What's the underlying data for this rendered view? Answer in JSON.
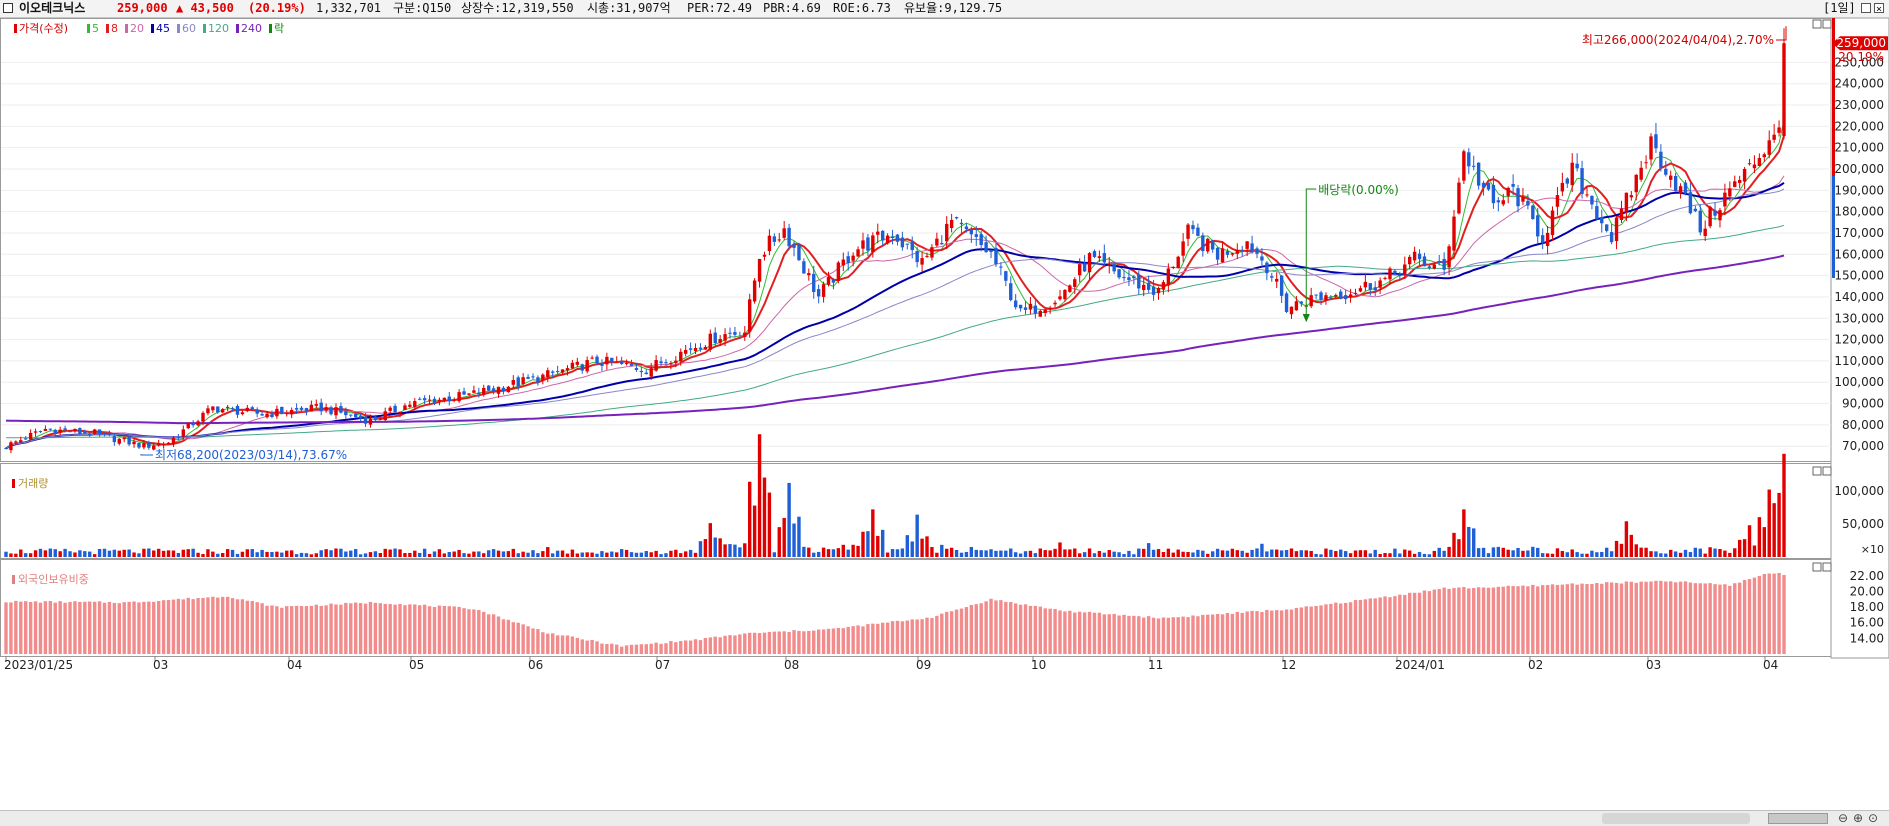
{
  "header": {
    "name": "이오테크닉스",
    "price": "259,000",
    "change": "▲ 43,500",
    "change_pct": "(20.19%)",
    "volume": "1,332,701",
    "market": "구분:Q150",
    "shares": "상장수:12,319,550",
    "mcap": "시총:31,907억",
    "per": "PER:72.49",
    "pbr": "PBR:4.69",
    "roe": "ROE:6.73",
    "float": "유보율:9,129.75",
    "period": "[1일]",
    "colors": {
      "up": "#e00000",
      "down": "#1f5fd6",
      "text": "#000000"
    }
  },
  "legend": {
    "price": "가격(수정)",
    "ma": [
      {
        "label": "5",
        "color": "#33bb33"
      },
      {
        "label": "8",
        "color": "#e02020"
      },
      {
        "label": "20",
        "color": "#cc66aa"
      },
      {
        "label": "45",
        "color": "#0000aa"
      },
      {
        "label": "60",
        "color": "#8888cc"
      },
      {
        "label": "120",
        "color": "#44aa88"
      },
      {
        "label": "240",
        "color": "#7722bb"
      }
    ],
    "ex": "락"
  },
  "annotations": {
    "high": "최고266,000(2024/04/04),2.70%",
    "low": "최저68,200(2023/03/14),73.67%",
    "dividend": "배당락(0.00%)",
    "last_price": "259,000",
    "last_pct": "20.19%"
  },
  "volume_panel": {
    "title": "거래량",
    "multiplier": "×10"
  },
  "foreign_panel": {
    "title": "외국인보유비중"
  },
  "xaxis_labels": [
    "2023/01/25",
    "03",
    "04",
    "05",
    "06",
    "07",
    "08",
    "09",
    "10",
    "11",
    "12",
    "2024/01",
    "02",
    "03",
    "04"
  ],
  "chart_data": [
    {
      "type": "candlestick",
      "title": "가격(수정)",
      "ylim": [
        64000,
        268000
      ],
      "yticks": [
        "70,000",
        "80,000",
        "90,000",
        "100,000",
        "110,000",
        "120,000",
        "130,000",
        "140,000",
        "150,000",
        "160,000",
        "170,000",
        "180,000",
        "190,000",
        "200,000",
        "210,000",
        "220,000",
        "230,000",
        "240,000",
        "250,000"
      ],
      "anchors": [
        [
          0,
          70000
        ],
        [
          8,
          78000
        ],
        [
          18,
          76000
        ],
        [
          28,
          70000
        ],
        [
          33,
          72000
        ],
        [
          42,
          88000
        ],
        [
          52,
          85000
        ],
        [
          64,
          88000
        ],
        [
          74,
          82000
        ],
        [
          82,
          90000
        ],
        [
          94,
          94000
        ],
        [
          108,
          102000
        ],
        [
          120,
          110000
        ],
        [
          130,
          106000
        ],
        [
          137,
          114000
        ],
        [
          145,
          122000
        ],
        [
          150,
          124000
        ],
        [
          153,
          160000
        ],
        [
          158,
          172000
        ],
        [
          165,
          140000
        ],
        [
          172,
          162000
        ],
        [
          180,
          170000
        ],
        [
          186,
          156000
        ],
        [
          192,
          175000
        ],
        [
          200,
          160000
        ],
        [
          206,
          132000
        ],
        [
          214,
          140000
        ],
        [
          220,
          158000
        ],
        [
          226,
          150000
        ],
        [
          234,
          142000
        ],
        [
          240,
          170000
        ],
        [
          246,
          160000
        ],
        [
          252,
          166000
        ],
        [
          256,
          155000
        ],
        [
          260,
          135000
        ],
        [
          266,
          140000
        ],
        [
          272,
          142000
        ],
        [
          280,
          148000
        ],
        [
          286,
          158000
        ],
        [
          292,
          152000
        ],
        [
          296,
          208000
        ],
        [
          302,
          182000
        ],
        [
          306,
          190000
        ],
        [
          312,
          168000
        ],
        [
          318,
          200000
        ],
        [
          326,
          168000
        ],
        [
          334,
          212000
        ],
        [
          340,
          190000
        ],
        [
          344,
          172000
        ],
        [
          350,
          190000
        ],
        [
          354,
          200000
        ],
        [
          357,
          210000
        ],
        [
          360,
          222000
        ]
      ],
      "last": {
        "open": 215500,
        "high": 266000,
        "low": 214000,
        "close": 259000
      },
      "moving_averages": [
        {
          "period": 5,
          "color": "#33bb33",
          "width": 1
        },
        {
          "period": 8,
          "color": "#e02020",
          "width": 2
        },
        {
          "period": 20,
          "color": "#cc66aa",
          "width": 1
        },
        {
          "period": 45,
          "color": "#0000aa",
          "width": 2
        },
        {
          "period": 60,
          "color": "#8888cc",
          "width": 1
        },
        {
          "period": 120,
          "color": "#44aa88",
          "width": 1
        },
        {
          "period": 240,
          "color": "#7722bb",
          "width": 2
        }
      ]
    },
    {
      "type": "bar",
      "title": "거래량",
      "ylim": [
        0,
        130000
      ],
      "yticks": [
        "50,000",
        "100,000"
      ],
      "peaks": [
        [
          0,
          8000
        ],
        [
          50,
          12000
        ],
        [
          110,
          15000
        ],
        [
          143,
          32000
        ],
        [
          153,
          116000
        ],
        [
          159,
          70000
        ],
        [
          176,
          45000
        ],
        [
          185,
          40000
        ],
        [
          214,
          22000
        ],
        [
          232,
          21000
        ],
        [
          255,
          20000
        ],
        [
          296,
          60000
        ],
        [
          329,
          45000
        ],
        [
          354,
          40000
        ],
        [
          358,
          85000
        ],
        [
          361,
          130000
        ]
      ]
    },
    {
      "type": "bar",
      "title": "외국인보유비중",
      "ylim": [
        12,
        23
      ],
      "yticks": [
        "14.00",
        "16.00",
        "18.00",
        "20.00",
        "22.00"
      ],
      "anchors": [
        [
          0,
          18.7
        ],
        [
          25,
          18.6
        ],
        [
          45,
          19.4
        ],
        [
          55,
          18.0
        ],
        [
          75,
          18.6
        ],
        [
          95,
          17.8
        ],
        [
          110,
          14.7
        ],
        [
          125,
          13.0
        ],
        [
          140,
          13.8
        ],
        [
          150,
          14.6
        ],
        [
          168,
          15.2
        ],
        [
          188,
          16.7
        ],
        [
          200,
          19.0
        ],
        [
          215,
          17.5
        ],
        [
          235,
          16.6
        ],
        [
          262,
          17.8
        ],
        [
          280,
          19.3
        ],
        [
          292,
          20.4
        ],
        [
          305,
          20.6
        ],
        [
          320,
          21.0
        ],
        [
          338,
          21.3
        ],
        [
          350,
          20.8
        ],
        [
          358,
          22.4
        ],
        [
          363,
          22.0
        ]
      ]
    }
  ]
}
